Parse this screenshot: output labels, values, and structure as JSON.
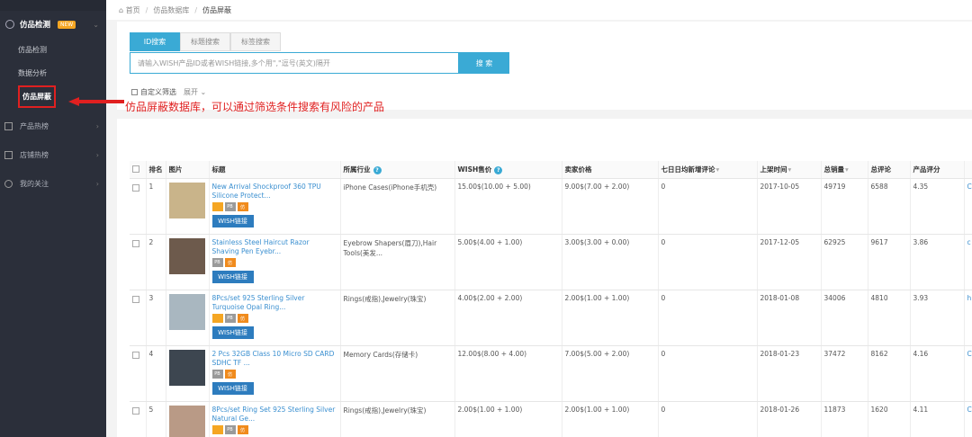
{
  "sidebar": {
    "group_label": "仿品检测",
    "group_badge": "NEW",
    "subs": [
      "仿品检测",
      "数据分析",
      "仿品屏蔽"
    ],
    "items": [
      "产品热榜",
      "店铺热榜",
      "我的关注"
    ]
  },
  "annotation": "仿品屏蔽数据库，可以通过筛选条件搜索有风险的产品",
  "breadcrumb": [
    "首页",
    "仿品数据库",
    "仿品屏蔽"
  ],
  "search": {
    "tabs": [
      "ID搜索",
      "标题搜索",
      "标签搜索"
    ],
    "placeholder": "请输入WISH产品ID或者WISH链接,多个用\",\"逗号(英文)隔开",
    "button": "搜 索",
    "filter_label": "自定义筛选",
    "expand_label": "展开"
  },
  "table": {
    "headers": [
      "排名",
      "图片",
      "标题",
      "所属行业",
      "WISH售价",
      "卖家价格",
      "七日日均新增评论",
      "上架时间",
      "总销量",
      "总评论",
      "产品评分"
    ],
    "button_label": "WISH链接",
    "rows": [
      {
        "rank": "1",
        "title": "New Arrival Shockproof 360 TPU Silicone Protect...",
        "industry": "iPhone Cases(iPhone手机壳)",
        "wish_price": "15.00$(10.00 + 5.00)",
        "seller_price": "9.00$(7.00 + 2.00)",
        "reviews7": "0",
        "date": "2017-10-05",
        "sales": "49719",
        "reviews": "6588",
        "rating": "4.35",
        "last": "C",
        "badges": [
          "o",
          "g",
          "f"
        ],
        "thumb": "#c9b48a"
      },
      {
        "rank": "2",
        "title": "Stainless Steel Haircut Razor Shaving Pen Eyebr...",
        "industry": "Eyebrow Shapers(眉刀),Hair Tools(美发...",
        "wish_price": "5.00$(4.00 + 1.00)",
        "seller_price": "3.00$(3.00 + 0.00)",
        "reviews7": "0",
        "date": "2017-12-05",
        "sales": "62925",
        "reviews": "9617",
        "rating": "3.86",
        "last": "c",
        "badges": [
          "g",
          "f"
        ],
        "thumb": "#6d5a4c"
      },
      {
        "rank": "3",
        "title": "8Pcs/set 925 Sterling Silver Turquoise Opal Ring...",
        "industry": "Rings(戒指),Jewelry(珠宝)",
        "wish_price": "4.00$(2.00 + 2.00)",
        "seller_price": "2.00$(1.00 + 1.00)",
        "reviews7": "0",
        "date": "2018-01-08",
        "sales": "34006",
        "reviews": "4810",
        "rating": "3.93",
        "last": "h",
        "badges": [
          "o",
          "g",
          "f"
        ],
        "thumb": "#a9b7c0"
      },
      {
        "rank": "4",
        "title": "2 Pcs 32GB Class 10 Micro SD CARD SDHC TF ...",
        "industry": "Memory Cards(存储卡)",
        "wish_price": "12.00$(8.00 + 4.00)",
        "seller_price": "7.00$(5.00 + 2.00)",
        "reviews7": "0",
        "date": "2018-01-23",
        "sales": "37472",
        "reviews": "8162",
        "rating": "4.16",
        "last": "C",
        "badges": [
          "g",
          "f"
        ],
        "thumb": "#3d4650"
      },
      {
        "rank": "5",
        "title": "8Pcs/set Ring Set 925 Sterling Silver Natural Ge...",
        "industry": "Rings(戒指),Jewelry(珠宝)",
        "wish_price": "2.00$(1.00 + 1.00)",
        "seller_price": "2.00$(1.00 + 1.00)",
        "reviews7": "0",
        "date": "2018-01-26",
        "sales": "11873",
        "reviews": "1620",
        "rating": "4.11",
        "last": "C",
        "badges": [
          "o",
          "g",
          "f"
        ],
        "thumb": "#b99a86"
      }
    ]
  },
  "badge_text": {
    "o": "",
    "g": "PB",
    "f": "仿"
  },
  "colors": {
    "accent": "#3aaad5",
    "link": "#3a8fd0",
    "annotation": "#e02020",
    "sidebar": "#2b2f3a"
  }
}
